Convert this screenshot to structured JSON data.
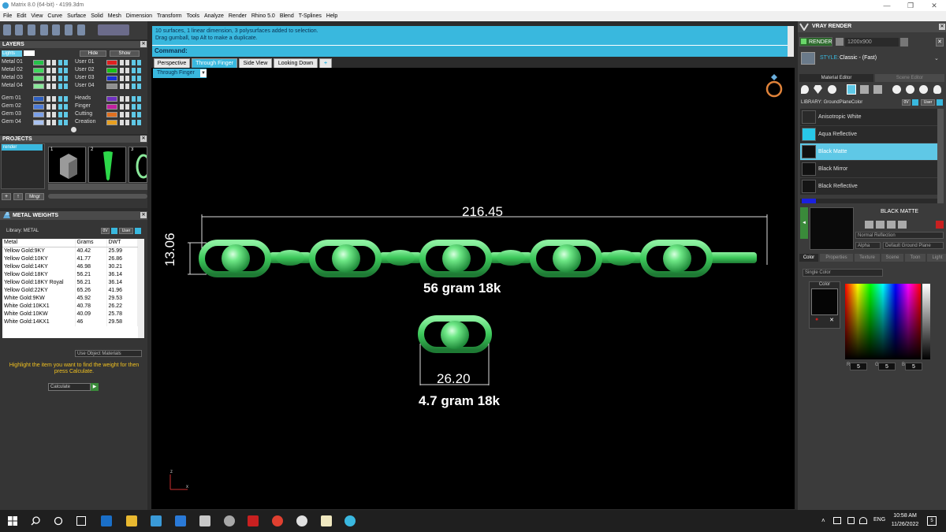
{
  "window": {
    "title": "Matrix 8.0 (64-bit) - 4199.3dm"
  },
  "menu": [
    "File",
    "Edit",
    "View",
    "Curve",
    "Surface",
    "Solid",
    "Mesh",
    "Dimension",
    "Transform",
    "Tools",
    "Analyze",
    "Render",
    "Rhino 5.0",
    "Blend",
    "T-Splines",
    "Help"
  ],
  "layers": {
    "title": "LAYERS",
    "current": "Lights",
    "hide_label": "Hide",
    "show_label": "Show",
    "left": [
      {
        "name": "Metal 01",
        "color": "#26c24a"
      },
      {
        "name": "Metal 02",
        "color": "#3fd85c"
      },
      {
        "name": "Metal 03",
        "color": "#67e07a"
      },
      {
        "name": "Metal 04",
        "color": "#8ae89a"
      },
      {
        "name": "Gem 01",
        "color": "#2e5fbf"
      },
      {
        "name": "Gem 02",
        "color": "#4b7ad8"
      },
      {
        "name": "Gem 03",
        "color": "#7aa0e8"
      },
      {
        "name": "Gem 04",
        "color": "#a9c2f0"
      }
    ],
    "right": [
      {
        "name": "User 01",
        "color": "#e02020"
      },
      {
        "name": "User 02",
        "color": "#18c018"
      },
      {
        "name": "User 03",
        "color": "#1830d8"
      },
      {
        "name": "User 04",
        "color": "#909090"
      },
      {
        "name": "Heads",
        "color": "#7030c0"
      },
      {
        "name": "Finger",
        "color": "#c020a0"
      },
      {
        "name": "Cutting",
        "color": "#e07020"
      },
      {
        "name": "Creation",
        "color": "#e8a020"
      }
    ]
  },
  "projects": {
    "title": "PROJECTS",
    "item": "render",
    "thumbs": [
      "1",
      "2",
      "3"
    ],
    "btn_minigr": "Mngr"
  },
  "metal_weights": {
    "title": "METAL WEIGHTS",
    "library_label": "Library: METAL",
    "ring_label": "0V",
    "user_label": "User",
    "columns": [
      "Metal",
      "Grams",
      "DWT"
    ],
    "rows": [
      [
        "Yellow Gold:9KY",
        "40.42",
        "25.99"
      ],
      [
        "Yellow Gold:10KY",
        "41.77",
        "26.86"
      ],
      [
        "Yellow Gold:14KY",
        "46.98",
        "30.21"
      ],
      [
        "Yellow Gold:18KY",
        "56.21",
        "36.14"
      ],
      [
        "Yellow Gold:18KY Royal",
        "56.21",
        "36.14"
      ],
      [
        "Yellow Gold:22KY",
        "65.26",
        "41.96"
      ],
      [
        "White Gold:9KW",
        "45.92",
        "29.53"
      ],
      [
        "White Gold:10KX1",
        "40.78",
        "26.22"
      ],
      [
        "White Gold:10KW",
        "40.09",
        "25.78"
      ],
      [
        "White Gold:14KX1",
        "46",
        "29.58"
      ]
    ],
    "use_object_materials": "Use Object Materials",
    "hint": "Highlight the item you want to find the weight for then press Calculate.",
    "calculate": "Calculate"
  },
  "command": {
    "log1": "10 surfaces, 1 linear dimension, 3 polysurfaces added to selection.",
    "log2": "Drag gumball, tap Alt to make a duplicate.",
    "prompt": "Command:"
  },
  "viewport_tabs": [
    "Perspective",
    "Through Finger",
    "Side View",
    "Looking Down"
  ],
  "viewport": {
    "label": "Through Finger",
    "dim_width": "216.45",
    "dim_height": "13.06",
    "chain_label": "56 gram 18k",
    "link_dim": "26.20",
    "link_label": "4.7 gram 18k",
    "axis_z": "z",
    "axis_x": "x"
  },
  "vray": {
    "title": "VRAY RENDER",
    "render_btn": "RENDER",
    "resolution": "1200x900",
    "style_label": "STYLE:",
    "style_value": "Classic - (Fast)",
    "tab_material": "Material Editor",
    "tab_scene": "Scene Editor",
    "library": "LIBRARY: GroundPlaneColor",
    "lib_ov": "0V",
    "lib_user": "User",
    "materials": [
      {
        "name": "Anisotropic White",
        "color": "#2a2a2a"
      },
      {
        "name": "Aqua Reflective",
        "color": "#28c8e8"
      },
      {
        "name": "Black Matte",
        "color": "#111111",
        "selected": true
      },
      {
        "name": "Black Mirror",
        "color": "#111111"
      },
      {
        "name": "Black Reflective",
        "color": "#151515"
      }
    ],
    "selected_name": "BLACK MATTE",
    "reflection": "Normal Reflection",
    "alpha": "Alpha",
    "ground": "Default Ground Plane",
    "subtabs": [
      "Color",
      "Properties",
      "Texture",
      "Scene",
      "Toon",
      "Light"
    ],
    "single_color": "Single Color",
    "color_label": "Color",
    "rgb": [
      "5",
      "5",
      "5"
    ],
    "rgb_labels": [
      "R",
      "G",
      "B"
    ]
  },
  "taskbar": {
    "lang": "ENG",
    "time": "10:58 AM",
    "date": "11/26/2022",
    "notif": "5"
  }
}
